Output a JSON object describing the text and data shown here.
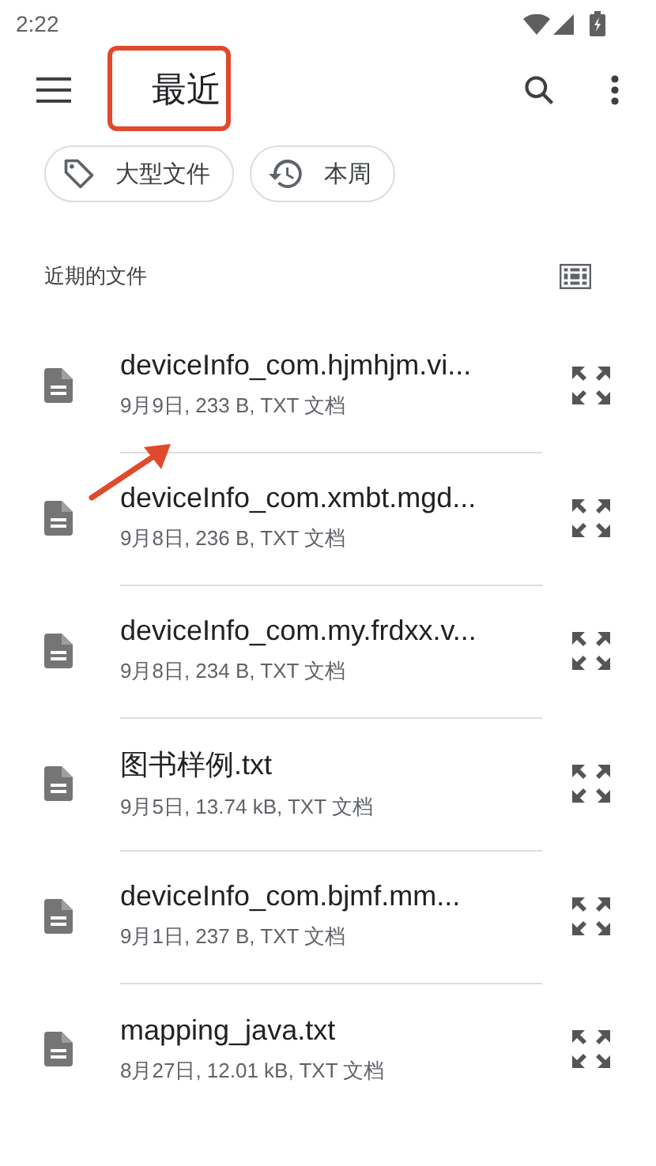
{
  "status_bar": {
    "time": "2:22"
  },
  "app_bar": {
    "title": "最近"
  },
  "chips": [
    {
      "kind": "tag",
      "label": "大型文件"
    },
    {
      "kind": "history",
      "label": "本周"
    }
  ],
  "section": {
    "title": "近期的文件"
  },
  "files": [
    {
      "name": "deviceInfo_com.hjmhjm.vi...",
      "meta": "9月9日, 233 B, TXT 文档"
    },
    {
      "name": "deviceInfo_com.xmbt.mgd...",
      "meta": "9月8日, 236 B, TXT 文档"
    },
    {
      "name": "deviceInfo_com.my.frdxx.v...",
      "meta": "9月8日, 234 B, TXT 文档"
    },
    {
      "name": "图书样例.txt",
      "meta": "9月5日, 13.74 kB, TXT 文档"
    },
    {
      "name": "deviceInfo_com.bjmf.mm...",
      "meta": "9月1日, 237 B, TXT 文档"
    },
    {
      "name": "mapping_java.txt",
      "meta": "8月27日, 12.01 kB, TXT 文档"
    }
  ]
}
